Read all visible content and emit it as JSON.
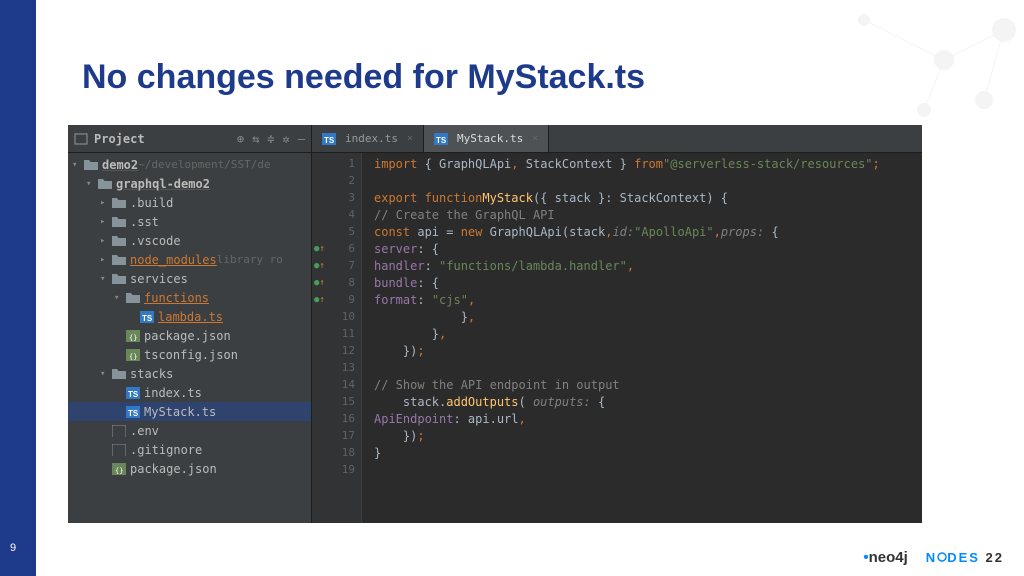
{
  "slide": {
    "title": "No changes needed for MyStack.ts",
    "page_number": "9"
  },
  "ide": {
    "project_panel": {
      "title": "Project",
      "tree": [
        {
          "depth": 0,
          "chev": "v",
          "icon": "folder",
          "label": "demo2",
          "bold": true,
          "suffix": "~/development/SST/de"
        },
        {
          "depth": 1,
          "chev": "v",
          "icon": "folder",
          "label": "graphql-demo2",
          "bold": true
        },
        {
          "depth": 2,
          "chev": ">",
          "icon": "folder",
          "label": ".build"
        },
        {
          "depth": 2,
          "chev": ">",
          "icon": "folder",
          "label": ".sst"
        },
        {
          "depth": 2,
          "chev": ">",
          "icon": "folder",
          "label": ".vscode"
        },
        {
          "depth": 2,
          "chev": ">",
          "icon": "folder",
          "label": "node_modules",
          "suffix": "library ro",
          "orange": true
        },
        {
          "depth": 2,
          "chev": "v",
          "icon": "folder",
          "label": "services"
        },
        {
          "depth": 3,
          "chev": "v",
          "icon": "folder",
          "label": "functions",
          "orange": true
        },
        {
          "depth": 4,
          "chev": "",
          "icon": "ts",
          "label": "lambda.ts",
          "orange": true
        },
        {
          "depth": 3,
          "chev": "",
          "icon": "json",
          "label": "package.json"
        },
        {
          "depth": 3,
          "chev": "",
          "icon": "json",
          "label": "tsconfig.json"
        },
        {
          "depth": 2,
          "chev": "v",
          "icon": "folder",
          "label": "stacks"
        },
        {
          "depth": 3,
          "chev": "",
          "icon": "ts",
          "label": "index.ts"
        },
        {
          "depth": 3,
          "chev": "",
          "icon": "ts",
          "label": "MyStack.ts",
          "selected": true
        },
        {
          "depth": 2,
          "chev": "",
          "icon": "file",
          "label": ".env"
        },
        {
          "depth": 2,
          "chev": "",
          "icon": "file",
          "label": ".gitignore"
        },
        {
          "depth": 2,
          "chev": "",
          "icon": "json",
          "label": "package.json"
        }
      ]
    },
    "tabs": [
      {
        "label": "index.ts",
        "active": false
      },
      {
        "label": "MyStack.ts",
        "active": true
      }
    ],
    "code": {
      "lines": [
        {
          "n": 1,
          "marker": "",
          "html": "<span class='kw'>import</span> { GraphQLApi<span class='kw'>,</span> StackContext } <span class='kw'>from</span> <span class='str'>\"@serverless-stack/resources\"</span><span class='kw'>;</span>"
        },
        {
          "n": 2,
          "marker": "",
          "html": ""
        },
        {
          "n": 3,
          "marker": "",
          "html": "<span class='kw'>export function</span> <span class='fn'>MyStack</span>({ stack }: StackContext) {"
        },
        {
          "n": 4,
          "marker": "",
          "html": "    <span class='com'>// Create the GraphQL API</span>"
        },
        {
          "n": 5,
          "marker": "",
          "html": "    <span class='kw'>const</span> api = <span class='kw'>new</span> GraphQLApi(stack<span class='kw'>,</span>  <span class='param'>id:</span> <span class='str'>\"ApolloApi\"</span><span class='kw'>,</span>  <span class='param'>props:</span> {"
        },
        {
          "n": 6,
          "marker": "ga",
          "html": "        <span class='prop'>server</span>: {"
        },
        {
          "n": 7,
          "marker": "ga",
          "html": "            <span class='prop'>handler</span>: <span class='str'>\"functions/lambda.handler\"</span><span class='kw'>,</span>"
        },
        {
          "n": 8,
          "marker": "ga",
          "html": "            <span class='prop'>bundle</span>: {"
        },
        {
          "n": 9,
          "marker": "ga",
          "html": "                <span class='prop'>format</span>: <span class='str'>\"cjs\"</span><span class='kw'>,</span>"
        },
        {
          "n": 10,
          "marker": "",
          "html": "            }<span class='kw'>,</span>"
        },
        {
          "n": 11,
          "marker": "",
          "html": "        }<span class='kw'>,</span>"
        },
        {
          "n": 12,
          "marker": "",
          "html": "    })<span class='kw'>;</span>"
        },
        {
          "n": 13,
          "marker": "",
          "html": ""
        },
        {
          "n": 14,
          "marker": "",
          "html": "    <span class='com'>// Show the API endpoint in output</span>"
        },
        {
          "n": 15,
          "marker": "",
          "html": "    stack.<span class='fn'>addOutputs</span>( <span class='param'>outputs:</span> {"
        },
        {
          "n": 16,
          "marker": "",
          "html": "        <span class='prop'>ApiEndpoint</span>: api.url<span class='kw'>,</span>"
        },
        {
          "n": 17,
          "marker": "",
          "html": "    })<span class='kw'>;</span>"
        },
        {
          "n": 18,
          "marker": "",
          "html": "}"
        },
        {
          "n": 19,
          "marker": "",
          "html": ""
        }
      ]
    }
  },
  "footer": {
    "neo4j": "neo4j",
    "nodes": "NODES",
    "year": "22"
  }
}
